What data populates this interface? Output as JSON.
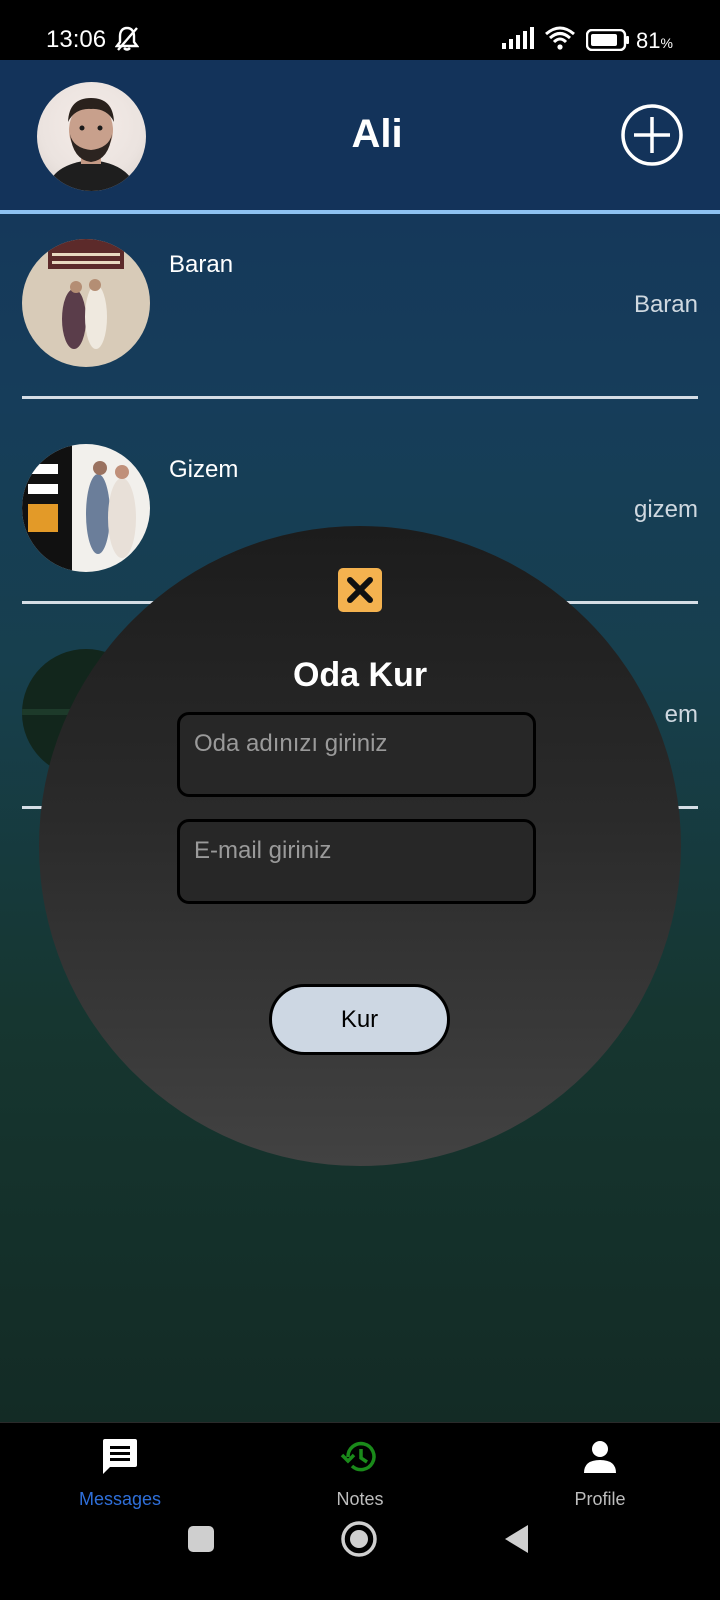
{
  "status_bar": {
    "time": "13:06",
    "battery_percent": "81",
    "battery_unit": "%"
  },
  "header": {
    "title": "Ali"
  },
  "chats": [
    {
      "name": "Baran",
      "preview": "Baran"
    },
    {
      "name": "Gizem",
      "preview": "gizem"
    },
    {
      "name": "",
      "preview": "em"
    }
  ],
  "dialog": {
    "title": "Oda Kur",
    "room_name_placeholder": "Oda adınızı giriniz",
    "email_placeholder": "E-mail giriniz",
    "submit_label": "Kur"
  },
  "bottom_nav": [
    {
      "label": "Messages",
      "icon": "chat-icon",
      "color": "#2f6fd9",
      "active": true
    },
    {
      "label": "Notes",
      "icon": "history-icon",
      "color": "#1a8a1a",
      "active": false
    },
    {
      "label": "Profile",
      "icon": "person-icon",
      "color": "#ffffff",
      "active": false
    }
  ],
  "colors": {
    "header_bg": "#13335a",
    "accent_line": "#8ec2f2",
    "close_button": "#f4b24f",
    "active_nav": "#2f6fd9"
  }
}
